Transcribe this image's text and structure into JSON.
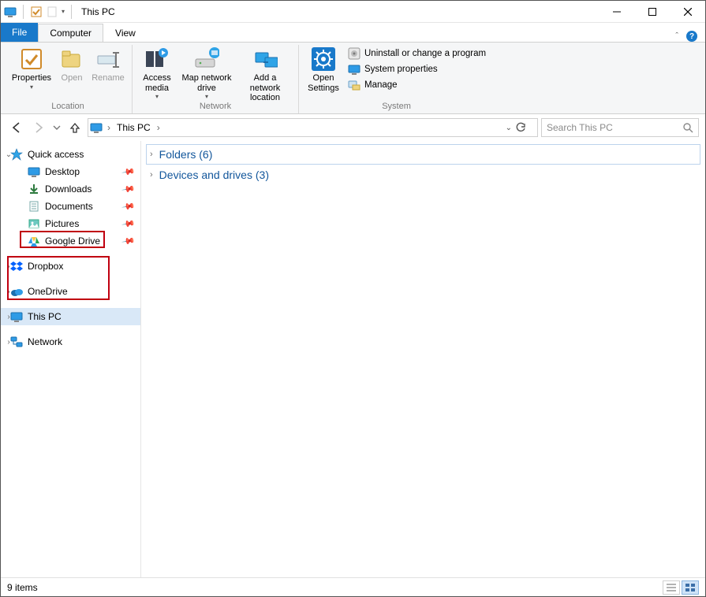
{
  "window": {
    "title": "This PC"
  },
  "tabs": {
    "file": "File",
    "computer": "Computer",
    "view": "View"
  },
  "ribbon": {
    "location": {
      "label": "Location",
      "properties": "Properties",
      "open": "Open",
      "rename": "Rename"
    },
    "network": {
      "label": "Network",
      "access_media": "Access media",
      "map_drive": "Map network drive",
      "add_location": "Add a network location"
    },
    "settings": {
      "open_settings": "Open Settings"
    },
    "system": {
      "label": "System",
      "uninstall": "Uninstall or change a program",
      "sys_props": "System properties",
      "manage": "Manage"
    }
  },
  "address": {
    "root": "This PC",
    "search_placeholder": "Search This PC"
  },
  "sidebar": {
    "quick_access": "Quick access",
    "items": [
      {
        "label": "Desktop"
      },
      {
        "label": "Downloads"
      },
      {
        "label": "Documents"
      },
      {
        "label": "Pictures"
      },
      {
        "label": "Google Drive"
      }
    ],
    "dropbox": "Dropbox",
    "onedrive": "OneDrive",
    "this_pc": "This PC",
    "network": "Network"
  },
  "content": {
    "folders": {
      "label": "Folders",
      "count": 6
    },
    "devices": {
      "label": "Devices and drives",
      "count": 3
    }
  },
  "status": {
    "items": "9 items"
  }
}
